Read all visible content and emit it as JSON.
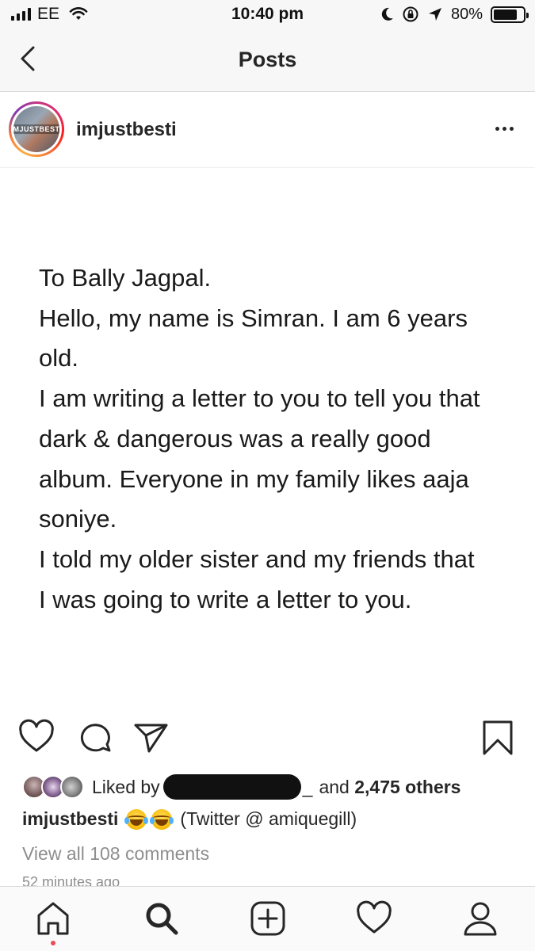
{
  "status_bar": {
    "carrier": "EE",
    "time": "10:40 pm",
    "battery_percent": "80%",
    "battery_level": 0.8,
    "icons": [
      "signal-icon",
      "wifi-icon",
      "moon-icon",
      "orientation-lock-icon",
      "location-icon",
      "battery-icon"
    ]
  },
  "header": {
    "title": "Posts",
    "back_icon": "chevron-left-icon"
  },
  "post": {
    "username": "imjustbesti",
    "avatar_text": "IMJUSTBESTI",
    "more_icon": "more-horizontal-icon",
    "letter_lines": [
      "To Bally Jagpal.",
      "Hello, my name is Simran. I am 6 years",
      "old.",
      "I am writing a letter to you to tell you that",
      "dark & dangerous was a really good",
      "album. Everyone in my family likes aaja",
      "soniye.",
      "I told my older sister and my friends that",
      "I was going to write a letter to you."
    ],
    "actions": {
      "like_icon": "heart-icon",
      "comment_icon": "comment-icon",
      "share_icon": "send-icon",
      "save_icon": "bookmark-icon"
    },
    "likes": {
      "prefix": "Liked by",
      "suffix_word": "and",
      "others": "2,475 others"
    },
    "caption": {
      "username": "imjustbesti",
      "text": "(Twitter @ amiquegill)",
      "emoji": "face-with-tears-of-joy"
    },
    "view_comments": "View all 108 comments",
    "timestamp": "52 minutes ago"
  },
  "tab_bar": {
    "items": [
      "home-icon",
      "search-icon",
      "new-post-icon",
      "activity-icon",
      "profile-icon"
    ],
    "notification_color": "#ed4956"
  },
  "colors": {
    "text": "#262626",
    "muted": "#8e8e8e",
    "divider": "#dbdbdb",
    "bar_background": "#f7f7f7"
  }
}
